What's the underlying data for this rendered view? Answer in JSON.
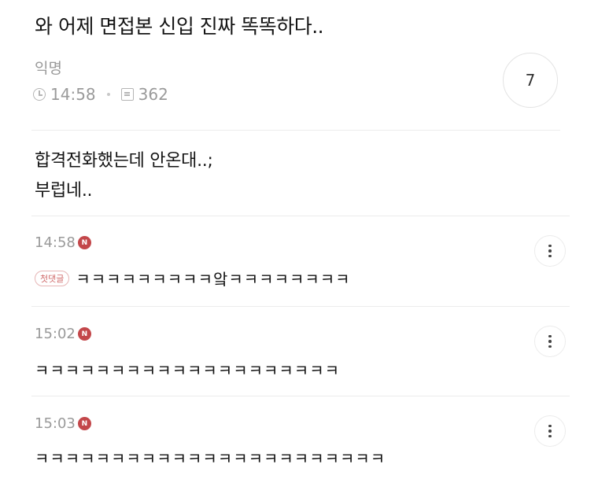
{
  "post": {
    "title": "와 어제 면접본 신입 진짜 똑똑하다..",
    "author": "익명",
    "time": "14:58",
    "views": "362",
    "comment_count": "7",
    "body_lines": [
      "합격전화했는데 안온대..;",
      "부럽네.."
    ]
  },
  "badges": {
    "new": "N",
    "first_comment": "첫댓글"
  },
  "comments": [
    {
      "time": "14:58",
      "text": "ㅋㅋㅋㅋㅋㅋㅋㅋㅋ앜ㅋㅋㅋㅋㅋㅋㅋㅋ"
    },
    {
      "time": "15:02",
      "text": "ㅋㅋㅋㅋㅋㅋㅋㅋㅋㅋㅋㅋㅋㅋㅋㅋㅋㅋㅋㅋ"
    },
    {
      "time": "15:03",
      "text": "ㅋㅋㅋㅋㅋㅋㅋㅋㅋㅋㅋㅋㅋㅋㅋㅋㅋㅋㅋㅋㅋㅋㅋ"
    }
  ],
  "icons": {
    "time": "clock-icon",
    "views": "view-count-icon",
    "more": "more-vertical-icon"
  },
  "colors": {
    "new_badge": "#c3474a",
    "muted_text": "#9a9a9a"
  }
}
